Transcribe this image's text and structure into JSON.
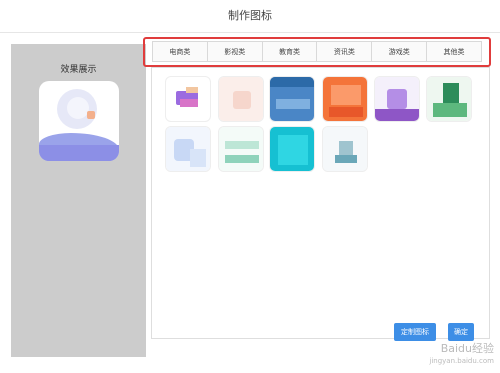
{
  "dialog": {
    "title": "制作图标"
  },
  "preview": {
    "label": "效果展示"
  },
  "categories": [
    {
      "label": "电商类"
    },
    {
      "label": "影视类"
    },
    {
      "label": "教育类"
    },
    {
      "label": "资讯类"
    },
    {
      "label": "游戏类"
    },
    {
      "label": "其他类"
    }
  ],
  "buttons": {
    "custom": "定制图标",
    "confirm": "确定"
  },
  "watermark": {
    "brand": "Baidu经验",
    "url": "jingyan.baidu.com"
  },
  "colors": {
    "accent": "#3d8ee6",
    "highlight": "#e03c3c"
  }
}
